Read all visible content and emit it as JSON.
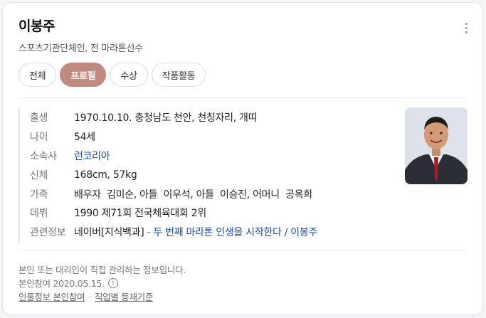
{
  "person": {
    "name": "이봉주",
    "description": "스포츠기관단체인, 전 마라톤선수"
  },
  "tabs": [
    {
      "label": "전체",
      "active": false
    },
    {
      "label": "프로필",
      "active": true
    },
    {
      "label": "수상",
      "active": false
    },
    {
      "label": "작품활동",
      "active": false
    }
  ],
  "profile": {
    "birth_label": "출생",
    "birth_value": "1970.10.10. 충청남도 천안, 천칭자리, 개띠",
    "age_label": "나이",
    "age_value": "54세",
    "agency_label": "소속사",
    "agency_value": "런코리아",
    "body_label": "신체",
    "body_value": "168cm, 57kg",
    "family_label": "가족",
    "family_value": "배우자  김미순, 아들  이우석, 아들  이승진, 어머니  공옥희",
    "debut_label": "데뷔",
    "debut_value": "1990 제71회 전국체육대회 2위",
    "related_label": "관련정보",
    "related_source": "네이버[지식백과]",
    "related_sep": " - ",
    "related_link": "두 번째 마라톤 인생을 시작한다 / 이봉주"
  },
  "footer": {
    "notice": "본인 또는 대리인이 직접 관리하는 정보입니다.",
    "verified": "본인참여 2020.05.15.",
    "link_1": "인물정보 본인참여",
    "link_2": "직업별 등재기준",
    "separator": "·"
  },
  "icons": {
    "more": "more-vertical-icon",
    "info": "info-circle-icon"
  },
  "colors": {
    "active_tab": "#c08a7e",
    "link": "#1a4bb5"
  }
}
